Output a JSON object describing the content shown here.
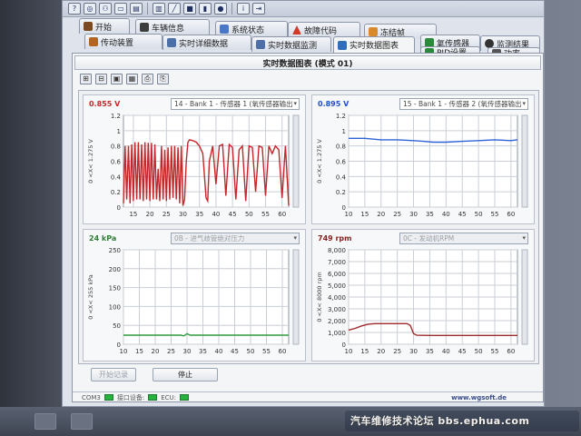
{
  "colors": {
    "red_series": "#c4262a",
    "blue_series": "#2e63d8",
    "green_series": "#2f9a3d",
    "darkred_series": "#9c2a2a",
    "label_red": "#c4262a",
    "label_blue": "#1f4fd0",
    "label_green": "#2f7d37",
    "label_maroon": "#8a1e1e"
  },
  "tabs_row1": [
    {
      "label": "开始",
      "icon": "start-icon"
    },
    {
      "label": "车辆信息",
      "icon": "car-info-icon"
    },
    {
      "label": "系统状态",
      "icon": "system-status-icon"
    },
    {
      "label": "故障代码",
      "icon": "warning-icon"
    },
    {
      "label": "冻结帧",
      "icon": "freeze-frame-icon"
    }
  ],
  "tabs_row2": [
    {
      "label": "传动装置",
      "icon": "transmission-icon"
    },
    {
      "label": "实时详细数据",
      "icon": "detail-data-icon"
    },
    {
      "label": "实时数据监测",
      "icon": "monitor-icon"
    },
    {
      "label": "实时数据图表",
      "icon": "chart-tab-icon"
    },
    {
      "label": "氧传感器",
      "icon": "oxygen-sensor-icon"
    },
    {
      "label": "监测结果",
      "icon": "results-icon"
    }
  ],
  "tabs_row3": [
    {
      "label": "PID设置",
      "icon": "pid-icon"
    },
    {
      "label": "功率",
      "icon": "power-icon"
    }
  ],
  "panel": {
    "title": "实时数据图表 (模式 01)"
  },
  "buttons": {
    "start": "开始记录",
    "stop": "停止"
  },
  "status": {
    "port": "COM3",
    "link": "接口设备:",
    "ecu": "ECU:",
    "site": "www.wgsoft.de"
  },
  "watermark": "汽车维修技术论坛 bbs.ephua.com",
  "chart_data": [
    {
      "type": "line",
      "value_text": "0.855 V",
      "value_color": "label_red",
      "selector": "14 - Bank 1 - 传感器 1 (氧传感器输出",
      "selector_disabled": false,
      "ylabel": "0 <X< 1.275 V",
      "ylim": [
        0,
        1.2
      ],
      "yticks": [
        "0",
        "0.2",
        "0.4",
        "0.6",
        "0.8",
        "1",
        "1.2"
      ],
      "xticks": [
        "15",
        "20",
        "25",
        "30",
        "35",
        "40",
        "45",
        "50",
        "55",
        "60"
      ],
      "xlim": [
        12,
        62
      ],
      "color": "red_series",
      "series": [
        {
          "x": [
            12,
            12.5,
            13,
            13.5,
            14,
            14.5,
            15,
            15.5,
            16,
            16.5,
            17,
            17.5,
            18,
            18.5,
            19,
            19.5,
            20,
            20.5,
            21,
            21.5,
            22,
            22.5,
            23,
            23.5,
            24,
            24.5,
            25,
            25.5,
            26,
            26.5,
            27,
            27.5,
            28,
            28.5,
            29,
            29.5,
            30,
            30.5,
            31,
            31.5,
            32,
            33,
            34,
            35,
            36,
            37,
            37.5,
            38,
            39,
            40,
            41,
            42,
            43,
            44,
            45,
            46,
            47,
            48,
            49,
            50,
            51,
            52,
            53,
            54,
            55,
            56,
            57,
            58,
            59,
            60,
            61,
            62
          ],
          "y": [
            0.05,
            0.8,
            0.1,
            0.8,
            0.05,
            0.82,
            0.08,
            0.85,
            0.1,
            0.85,
            0.1,
            0.82,
            0.08,
            0.85,
            0.1,
            0.84,
            0.08,
            0.84,
            0.1,
            0.82,
            0.1,
            0.5,
            0.08,
            0.8,
            0.1,
            0.75,
            0.08,
            0.78,
            0.1,
            0.8,
            0.12,
            0.8,
            0.1,
            0.78,
            0.05,
            0.8,
            0.02,
            0.1,
            0.6,
            0.85,
            0.88,
            0.87,
            0.85,
            0.8,
            0.7,
            0.12,
            0.08,
            0.6,
            0.8,
            0.3,
            0.8,
            0.82,
            0.15,
            0.82,
            0.78,
            0.1,
            0.75,
            0.8,
            0.08,
            0.8,
            0.78,
            0.2,
            0.8,
            0.78,
            0.15,
            0.8,
            0.7,
            0.8,
            0.75,
            0.12,
            0.8,
            0.02
          ]
        }
      ]
    },
    {
      "type": "line",
      "value_text": "0.895 V",
      "value_color": "label_blue",
      "selector": "15 - Bank 1 - 传感器 2 (氧传感器输出",
      "selector_disabled": false,
      "ylabel": "0 <X< 1.275 V",
      "ylim": [
        0,
        1.2
      ],
      "yticks": [
        "0",
        "0.2",
        "0.4",
        "0.6",
        "0.8",
        "1",
        "1.2"
      ],
      "xticks": [
        "10",
        "15",
        "20",
        "25",
        "30",
        "35",
        "40",
        "45",
        "50",
        "55",
        "60"
      ],
      "xlim": [
        10,
        62
      ],
      "color": "blue_series",
      "series": [
        {
          "x": [
            10,
            15,
            20,
            25,
            30,
            33,
            36,
            40,
            45,
            50,
            55,
            60,
            62
          ],
          "y": [
            0.9,
            0.9,
            0.88,
            0.88,
            0.87,
            0.86,
            0.85,
            0.85,
            0.86,
            0.87,
            0.88,
            0.87,
            0.88
          ]
        }
      ]
    },
    {
      "type": "line",
      "value_text": "24 kPa",
      "value_color": "label_green",
      "selector": "0B - 进气歧管绝对压力",
      "selector_disabled": true,
      "ylabel": "0 <X< 255 kPa",
      "ylim": [
        0,
        250
      ],
      "yticks": [
        "0",
        "50",
        "100",
        "150",
        "200",
        "250"
      ],
      "xticks": [
        "10",
        "15",
        "20",
        "25",
        "30",
        "35",
        "40",
        "45",
        "50",
        "55",
        "60"
      ],
      "xlim": [
        10,
        62
      ],
      "color": "green_series",
      "series": [
        {
          "x": [
            10,
            20,
            28,
            29,
            30,
            31,
            32,
            40,
            50,
            60,
            62
          ],
          "y": [
            24,
            24,
            24,
            22,
            28,
            24,
            24,
            24,
            24,
            24,
            24
          ]
        }
      ]
    },
    {
      "type": "line",
      "value_text": "749 rpm",
      "value_color": "label_maroon",
      "selector": "0C - 发动机RPM",
      "selector_disabled": true,
      "ylabel": "0 <X< 8000 rpm",
      "ylim": [
        0,
        8000
      ],
      "yticks": [
        "0",
        "1,000",
        "2,000",
        "3,000",
        "4,000",
        "5,000",
        "6,000",
        "7,000",
        "8,000"
      ],
      "xticks": [
        "10",
        "15",
        "20",
        "25",
        "30",
        "35",
        "40",
        "45",
        "50",
        "55",
        "60"
      ],
      "xlim": [
        10,
        62
      ],
      "color": "darkred_series",
      "series": [
        {
          "x": [
            10,
            12,
            14,
            16,
            18,
            20,
            22,
            24,
            26,
            28,
            29,
            30,
            31,
            35,
            40,
            45,
            50,
            55,
            60,
            62
          ],
          "y": [
            1200,
            1350,
            1550,
            1700,
            1750,
            1750,
            1750,
            1750,
            1750,
            1750,
            1600,
            900,
            760,
            750,
            749,
            749,
            749,
            749,
            749,
            749
          ]
        }
      ]
    }
  ]
}
